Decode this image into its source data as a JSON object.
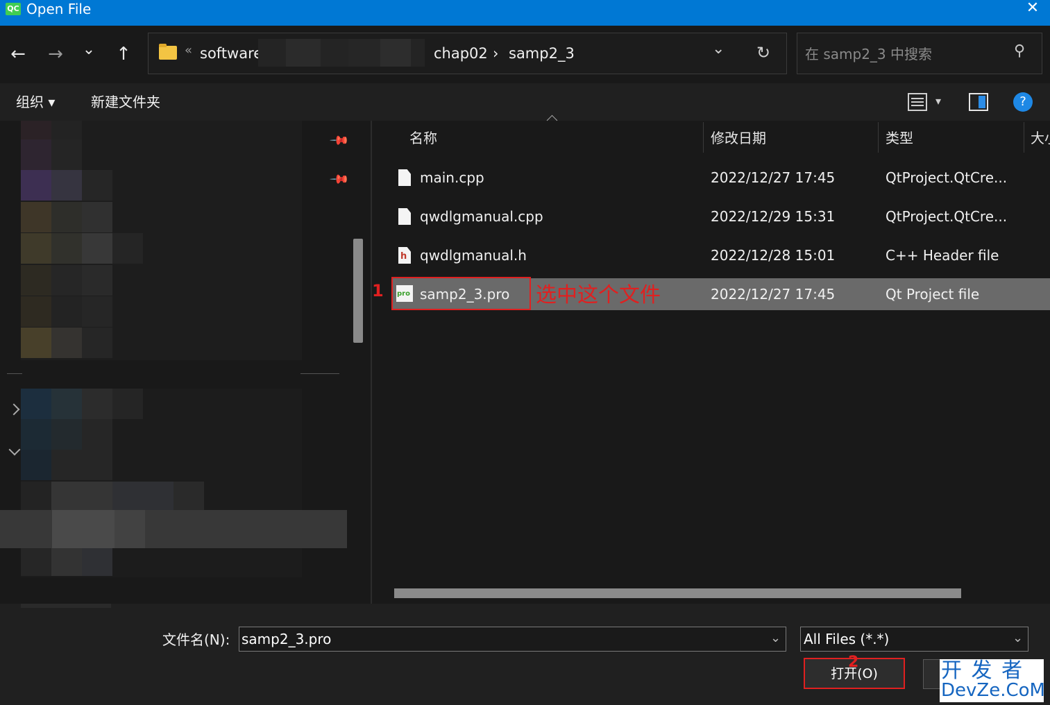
{
  "window": {
    "app_icon_text": "QC",
    "title": "Open File",
    "close_glyph": "✕"
  },
  "nav": {
    "back_glyph": "←",
    "forward_glyph": "→",
    "recent_glyph": "⌄",
    "up_glyph": "↑"
  },
  "address": {
    "chevron": "«",
    "crumbs": [
      "software",
      "chap02",
      "›",
      "samp2_3"
    ],
    "dropdown_glyph": "⌄",
    "refresh_glyph": "↻"
  },
  "search": {
    "placeholder": "在 samp2_3 中搜索",
    "icon_glyph": "⚲"
  },
  "toolbar": {
    "organize_label": "组织 ▾",
    "new_folder_label": "新建文件夹",
    "view_dropdown_glyph": "▾",
    "help_glyph": "?"
  },
  "columns": {
    "name": "名称",
    "modified": "修改日期",
    "type": "类型",
    "size": "大小"
  },
  "files": [
    {
      "name": "main.cpp",
      "modified": "2022/12/27 17:45",
      "type": "QtProject.QtCre...",
      "icon": "cpp-file-icon"
    },
    {
      "name": "qwdlgmanual.cpp",
      "modified": "2022/12/29 15:31",
      "type": "QtProject.QtCre...",
      "icon": "cpp-file-icon"
    },
    {
      "name": "qwdlgmanual.h",
      "modified": "2022/12/28 15:01",
      "type": "C++ Header file",
      "icon": "header-file-icon",
      "icon_text": "h"
    },
    {
      "name": "samp2_3.pro",
      "modified": "2022/12/27 17:45",
      "type": "Qt Project file",
      "icon": "qt-pro-file-icon",
      "icon_text": "pro",
      "selected": true
    }
  ],
  "annotations": {
    "step1": "1",
    "step1_text": "选中这个文件",
    "step2": "2"
  },
  "bottom": {
    "filename_label": "文件名(N):",
    "filename_value": "samp2_3.pro",
    "filter_value": "All Files (*.*)",
    "open_label": "打开(O)",
    "dropdown_glyph": "⌄"
  },
  "watermark": {
    "line1": "开 发 者",
    "line2": "DevZe.CoM"
  },
  "colors": {
    "titlebar": "#0078d4",
    "selection": "#6a6a6a",
    "annotation": "#e02020",
    "help": "#1e88e5"
  }
}
